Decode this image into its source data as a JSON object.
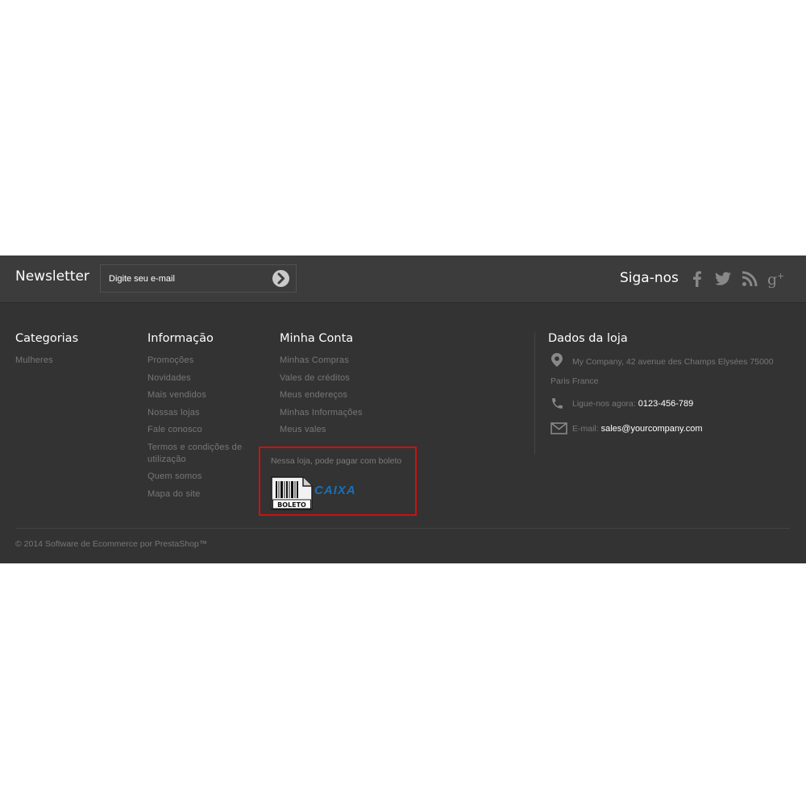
{
  "newsletter": {
    "title": "Newsletter",
    "placeholder": "Digite seu e-mail"
  },
  "social": {
    "title": "Siga-nos",
    "icons": [
      "facebook-icon",
      "twitter-icon",
      "rss-icon",
      "google-plus-icon"
    ]
  },
  "categories": {
    "title": "Categorias",
    "items": [
      "Mulheres"
    ]
  },
  "information": {
    "title": "Informação",
    "items": [
      "Promoções",
      "Novidades",
      "Mais vendidos",
      "Nossas lojas",
      "Fale conosco",
      "Termos e condições de utilização",
      "Quem somos",
      "Mapa do site"
    ]
  },
  "account": {
    "title": "Minha Conta",
    "items": [
      "Minhas Compras",
      "Vales de créditos",
      "Meus endereços",
      "Minhas Informações",
      "Meus vales"
    ]
  },
  "boleto": {
    "text": "Nessa loja, pode pagar com boleto",
    "boleto_label": "BOLETO",
    "caixa_label": "CAIXA"
  },
  "store": {
    "title": "Dados da loja",
    "address": "My Company, 42 avenue des Champs Elysées 75000 Paris France",
    "phone_label": "Ligue-nos agora:",
    "phone": "0123-456-789",
    "email_label": "E-mail:",
    "email": "sales@yourcompany.com"
  },
  "copyright": "© 2014 Software de Ecommerce por PrestaShop™",
  "colors": {
    "footer_bg": "#333333",
    "topbar_bg": "#3c3c3c",
    "highlight_border": "#d40e0e",
    "caixa_blue": "#1a6fb7"
  }
}
